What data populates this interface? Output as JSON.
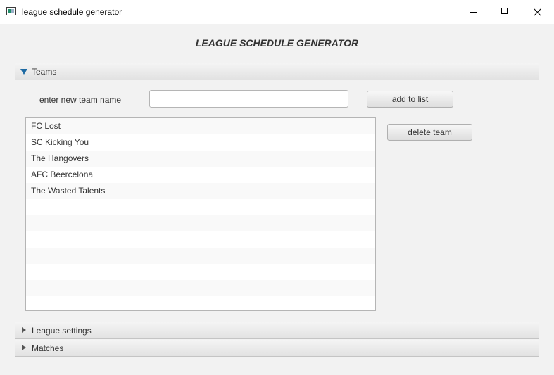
{
  "window": {
    "title": "league schedule generator",
    "controls": {
      "minimize": "minimize",
      "maximize": "maximize",
      "close": "close"
    }
  },
  "heading": "LEAGUE SCHEDULE GENERATOR",
  "accordion": {
    "teams": {
      "label": "Teams",
      "expanded": true,
      "input_label": "enter new team name",
      "input_value": "",
      "add_button": "add to list",
      "delete_button": "delete team",
      "teams": [
        "FC Lost",
        "SC Kicking You",
        "The Hangovers",
        "AFC Beercelona",
        "The Wasted Talents"
      ]
    },
    "league_settings": {
      "label": "League settings",
      "expanded": false
    },
    "matches": {
      "label": "Matches",
      "expanded": false
    }
  },
  "colors": {
    "expand_arrow": "#1e6aa3",
    "window_bg": "#f2f2f2"
  }
}
